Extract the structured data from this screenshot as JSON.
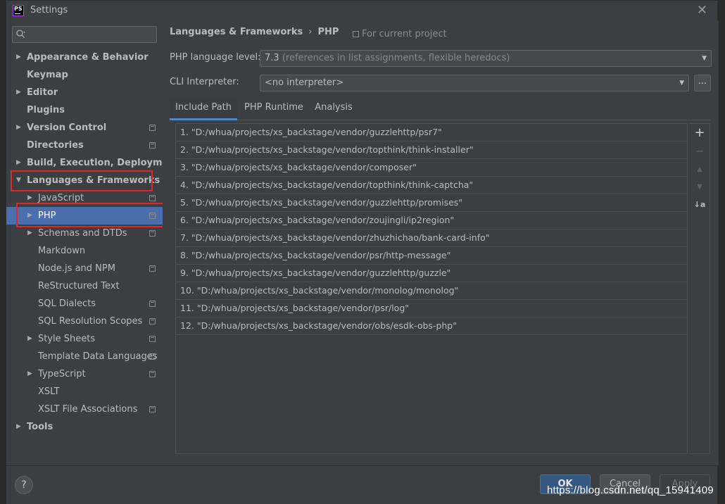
{
  "window": {
    "title": "Settings",
    "logo_text": "PS"
  },
  "sidebar": {
    "search_placeholder": "",
    "items": [
      {
        "label": "Appearance & Behavior",
        "bold": true,
        "arrow": "right",
        "indent": 0,
        "project_icon": false
      },
      {
        "label": "Keymap",
        "bold": true,
        "arrow": "",
        "indent": 0,
        "project_icon": false
      },
      {
        "label": "Editor",
        "bold": true,
        "arrow": "right",
        "indent": 0,
        "project_icon": false
      },
      {
        "label": "Plugins",
        "bold": true,
        "arrow": "",
        "indent": 0,
        "project_icon": false
      },
      {
        "label": "Version Control",
        "bold": true,
        "arrow": "right",
        "indent": 0,
        "project_icon": true
      },
      {
        "label": "Directories",
        "bold": true,
        "arrow": "",
        "indent": 0,
        "project_icon": true
      },
      {
        "label": "Build, Execution, Deployment",
        "bold": true,
        "arrow": "right",
        "indent": 0,
        "project_icon": false
      },
      {
        "label": "Languages & Frameworks",
        "bold": true,
        "arrow": "down",
        "indent": 0,
        "project_icon": false
      },
      {
        "label": "JavaScript",
        "bold": false,
        "arrow": "right",
        "indent": 1,
        "project_icon": true
      },
      {
        "label": "PHP",
        "bold": false,
        "arrow": "right",
        "indent": 1,
        "project_icon": true,
        "selected": true
      },
      {
        "label": "Schemas and DTDs",
        "bold": false,
        "arrow": "right",
        "indent": 1,
        "project_icon": true
      },
      {
        "label": "Markdown",
        "bold": false,
        "arrow": "",
        "indent": 1,
        "project_icon": false
      },
      {
        "label": "Node.js and NPM",
        "bold": false,
        "arrow": "",
        "indent": 1,
        "project_icon": true
      },
      {
        "label": "ReStructured Text",
        "bold": false,
        "arrow": "",
        "indent": 1,
        "project_icon": false
      },
      {
        "label": "SQL Dialects",
        "bold": false,
        "arrow": "",
        "indent": 1,
        "project_icon": true
      },
      {
        "label": "SQL Resolution Scopes",
        "bold": false,
        "arrow": "",
        "indent": 1,
        "project_icon": true
      },
      {
        "label": "Style Sheets",
        "bold": false,
        "arrow": "right",
        "indent": 1,
        "project_icon": true
      },
      {
        "label": "Template Data Languages",
        "bold": false,
        "arrow": "",
        "indent": 1,
        "project_icon": true
      },
      {
        "label": "TypeScript",
        "bold": false,
        "arrow": "right",
        "indent": 1,
        "project_icon": true
      },
      {
        "label": "XSLT",
        "bold": false,
        "arrow": "",
        "indent": 1,
        "project_icon": false
      },
      {
        "label": "XSLT File Associations",
        "bold": false,
        "arrow": "",
        "indent": 1,
        "project_icon": true
      },
      {
        "label": "Tools",
        "bold": true,
        "arrow": "right",
        "indent": 0,
        "project_icon": false
      }
    ]
  },
  "main": {
    "breadcrumb": {
      "parent": "Languages & Frameworks",
      "separator": "›",
      "current": "PHP"
    },
    "scope_note": "For current project",
    "language_level": {
      "label": "PHP language level:",
      "value": "7.3",
      "value_note": "(references in list assignments, flexible heredocs)"
    },
    "cli_interpreter": {
      "label": "CLI Interpreter:",
      "value": "<no interpreter>",
      "browse_label": "..."
    },
    "tabs": [
      {
        "label": "Include Path",
        "active": true
      },
      {
        "label": "PHP Runtime",
        "active": false
      },
      {
        "label": "Analysis",
        "active": false
      }
    ],
    "include_paths": [
      "1. \"D:/whua/projects/xs_backstage/vendor/guzzlehttp/psr7\"",
      "2. \"D:/whua/projects/xs_backstage/vendor/topthink/think-installer\"",
      "3. \"D:/whua/projects/xs_backstage/vendor/composer\"",
      "4. \"D:/whua/projects/xs_backstage/vendor/topthink/think-captcha\"",
      "5. \"D:/whua/projects/xs_backstage/vendor/guzzlehttp/promises\"",
      "6. \"D:/whua/projects/xs_backstage/vendor/zoujingli/ip2region\"",
      "7. \"D:/whua/projects/xs_backstage/vendor/zhuzhichao/bank-card-info\"",
      "8. \"D:/whua/projects/xs_backstage/vendor/psr/http-message\"",
      "9. \"D:/whua/projects/xs_backstage/vendor/guzzlehttp/guzzle\"",
      "10. \"D:/whua/projects/xs_backstage/vendor/monolog/monolog\"",
      "11. \"D:/whua/projects/xs_backstage/vendor/psr/log\"",
      "12. \"D:/whua/projects/xs_backstage/vendor/obs/esdk-obs-php\""
    ],
    "tools": {
      "add": "+",
      "remove": "−",
      "move_up": "▲",
      "move_down": "▼",
      "sort": "↓a"
    }
  },
  "footer": {
    "help": "?",
    "ok": "OK",
    "cancel": "Cancel",
    "apply": "Apply"
  },
  "watermark": "https://blog.csdn.net/qq_15941409",
  "colors": {
    "background": "#3c3f41",
    "selection": "#4b6eaf",
    "highlight_box": "#e3262a",
    "tab_underline": "#4a88c7",
    "ok_button": "#365880"
  }
}
